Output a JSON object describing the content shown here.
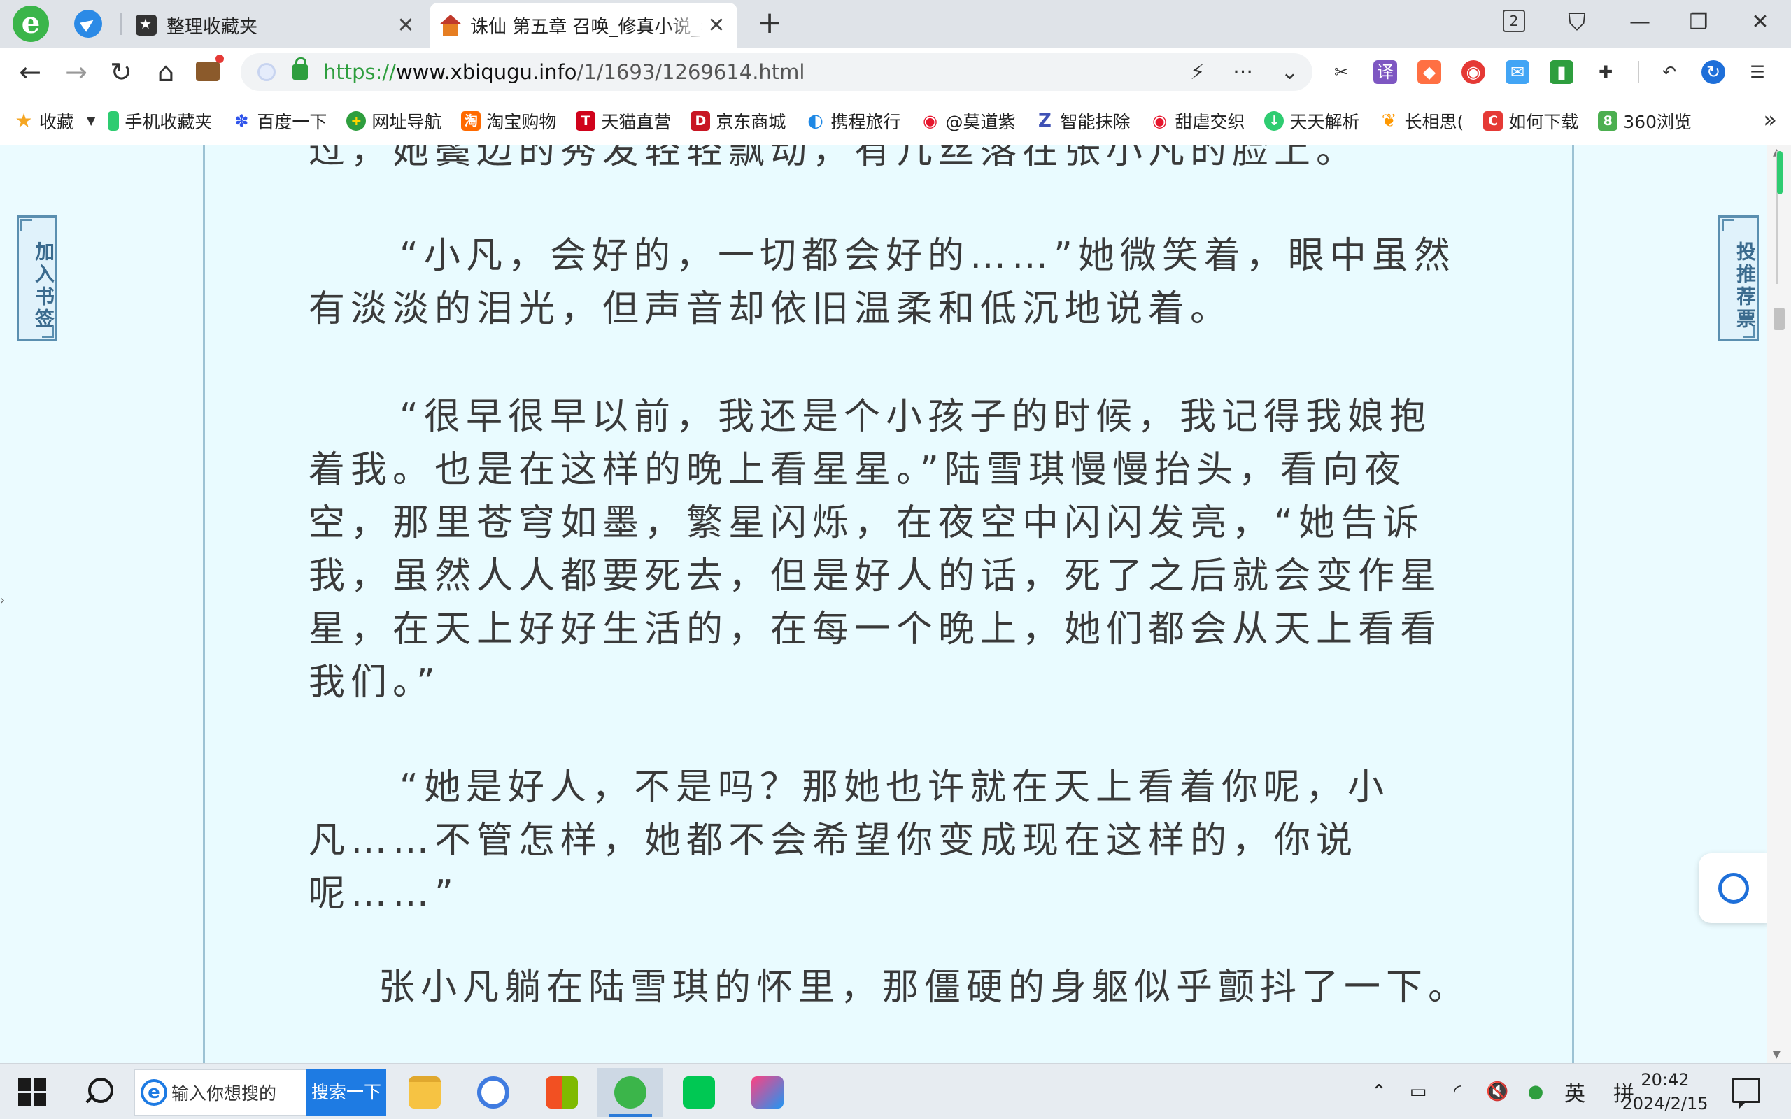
{
  "browser": {
    "tabs": [
      {
        "title": "整理收藏夹",
        "active": false
      },
      {
        "title": "诛仙 第五章 召唤_修真小说_看",
        "active": true
      }
    ],
    "tab_count": "2",
    "url": {
      "protocol": "https://",
      "host": "www.xbiqugu.info",
      "path": "/1/1693/1269614.html"
    },
    "bookmarks": [
      {
        "label": "收藏",
        "icon": "star-icon",
        "color": "#f5a623"
      },
      {
        "label": "手机收藏夹",
        "icon": "phone-icon",
        "color": "#2ecc71"
      },
      {
        "label": "百度一下",
        "icon": "baidu-paw-icon",
        "color": "#2f54eb"
      },
      {
        "label": "网址导航",
        "icon": "nav-plus-icon",
        "color": "#2e9e3e"
      },
      {
        "label": "淘宝购物",
        "icon": "taobao-icon",
        "color": "#ff6a00"
      },
      {
        "label": "天猫直营",
        "icon": "tmall-icon",
        "color": "#d0021b"
      },
      {
        "label": "京东商城",
        "icon": "jd-icon",
        "color": "#c81623"
      },
      {
        "label": "携程旅行",
        "icon": "ctrip-icon",
        "color": "#1e88e5"
      },
      {
        "label": "@莫道紫",
        "icon": "weibo-icon",
        "color": "#e6162d"
      },
      {
        "label": "智能抹除",
        "icon": "erase-icon",
        "color": "#3f51b5"
      },
      {
        "label": "甜虐交织",
        "icon": "weibo-icon",
        "color": "#e6162d"
      },
      {
        "label": "天天解析",
        "icon": "download-icon",
        "color": "#2ecc71"
      },
      {
        "label": "长相思(",
        "icon": "feather-icon",
        "color": "#ff9800"
      },
      {
        "label": "如何下载",
        "icon": "c-icon",
        "color": "#e53935"
      },
      {
        "label": "360浏览",
        "icon": "360-icon",
        "color": "#4caf50"
      }
    ]
  },
  "reader": {
    "left_button": "加入书签",
    "right_button": "投推荐票",
    "paragraphs": [
      "过，她鬓边的秀发轻轻飘动，有几丝落在张小凡的脸上。",
      "“小凡，会好的，一切都会好的……”她微笑着，眼中虽然有淡淡的泪光，但声音却依旧温柔和低沉地说着。",
      "“很早很早以前，我还是个小孩子的时候，我记得我娘抱着我。也是在这样的晚上看星星。”陆雪琪慢慢抬头，看向夜空，那里苍穹如墨，繁星闪烁，在夜空中闪闪发亮，“她告诉我，虽然人人都要死去，但是好人的话，死了之后就会变作星星，在天上好好生活的，在每一个晚上，她们都会从天上看看我们。”",
      "“她是好人，不是吗？那她也许就在天上看着你呢，小凡……不管怎样，她都不会希望你变成现在这样的，你说呢……”",
      "张小凡躺在陆雪琪的怀里，那僵硬的身躯似乎颤抖了一下。"
    ]
  },
  "taskbar": {
    "search_placeholder": "输入你想搜的",
    "search_button": "搜索一下",
    "ime_lang": "英",
    "ime_mode": "拼",
    "time": "20:42",
    "date": "2024/2/15"
  }
}
